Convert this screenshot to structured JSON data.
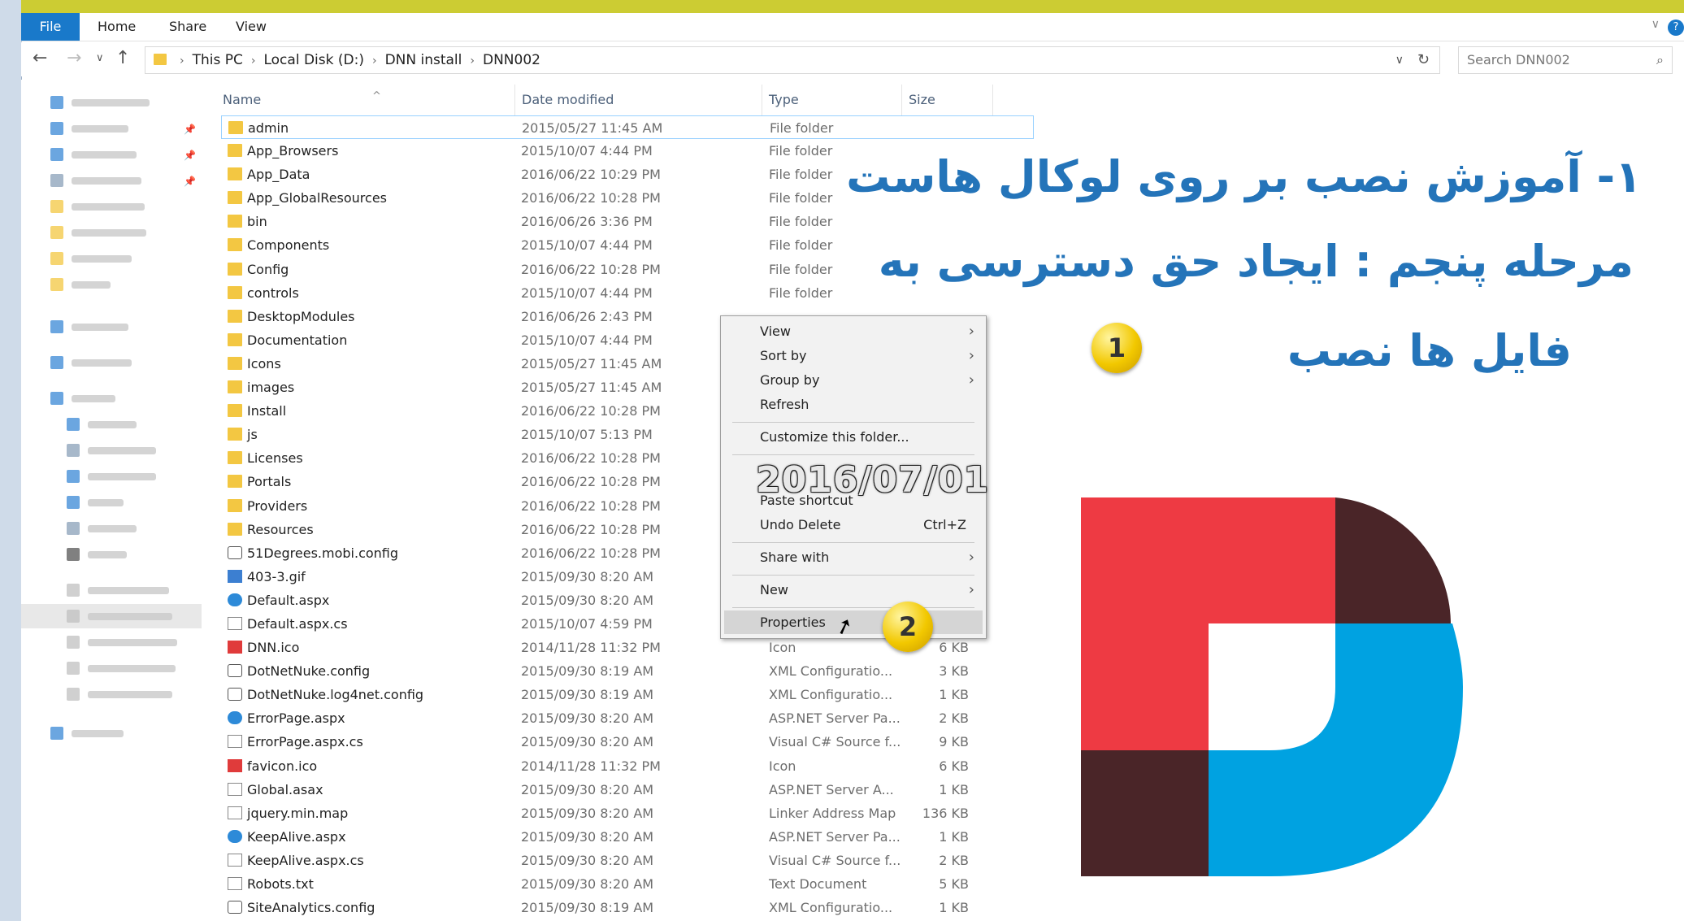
{
  "ribbon": {
    "tabs": [
      "File",
      "Home",
      "Share",
      "View"
    ]
  },
  "address": {
    "crumbs": [
      "This PC",
      "Local Disk (D:)",
      "DNN install",
      "DNN002"
    ]
  },
  "search": {
    "placeholder": "Search DNN002"
  },
  "columns": {
    "name": "Name",
    "date": "Date modified",
    "type": "Type",
    "size": "Size"
  },
  "files": [
    {
      "name": "admin",
      "date": "2015/05/27 11:45 AM",
      "type": "File folder",
      "size": "",
      "icon": "folder"
    },
    {
      "name": "App_Browsers",
      "date": "2015/10/07 4:44 PM",
      "type": "File folder",
      "size": "",
      "icon": "folder"
    },
    {
      "name": "App_Data",
      "date": "2016/06/22 10:29 PM",
      "type": "File folder",
      "size": "",
      "icon": "folder"
    },
    {
      "name": "App_GlobalResources",
      "date": "2016/06/22 10:28 PM",
      "type": "File folder",
      "size": "",
      "icon": "folder"
    },
    {
      "name": "bin",
      "date": "2016/06/26 3:36 PM",
      "type": "File folder",
      "size": "",
      "icon": "folder"
    },
    {
      "name": "Components",
      "date": "2015/10/07 4:44 PM",
      "type": "File folder",
      "size": "",
      "icon": "folder"
    },
    {
      "name": "Config",
      "date": "2016/06/22 10:28 PM",
      "type": "File folder",
      "size": "",
      "icon": "folder"
    },
    {
      "name": "controls",
      "date": "2015/10/07 4:44 PM",
      "type": "File folder",
      "size": "",
      "icon": "folder"
    },
    {
      "name": "DesktopModules",
      "date": "2016/06/26 2:43 PM",
      "type": "",
      "size": "",
      "icon": "folder"
    },
    {
      "name": "Documentation",
      "date": "2015/10/07 4:44 PM",
      "type": "",
      "size": "",
      "icon": "folder"
    },
    {
      "name": "Icons",
      "date": "2015/05/27 11:45 AM",
      "type": "",
      "size": "",
      "icon": "folder"
    },
    {
      "name": "images",
      "date": "2015/05/27 11:45 AM",
      "type": "",
      "size": "",
      "icon": "folder"
    },
    {
      "name": "Install",
      "date": "2016/06/22 10:28 PM",
      "type": "",
      "size": "",
      "icon": "folder"
    },
    {
      "name": "js",
      "date": "2015/10/07 5:13 PM",
      "type": "",
      "size": "",
      "icon": "folder"
    },
    {
      "name": "Licenses",
      "date": "2016/06/22 10:28 PM",
      "type": "",
      "size": "",
      "icon": "folder"
    },
    {
      "name": "Portals",
      "date": "2016/06/22 10:28 PM",
      "type": "",
      "size": "",
      "icon": "folder"
    },
    {
      "name": "Providers",
      "date": "2016/06/22 10:28 PM",
      "type": "",
      "size": "",
      "icon": "folder"
    },
    {
      "name": "Resources",
      "date": "2016/06/22 10:28 PM",
      "type": "",
      "size": "",
      "icon": "folder"
    },
    {
      "name": "51Degrees.mobi.config",
      "date": "2016/06/22 10:28 PM",
      "type": "",
      "size": "",
      "icon": "config"
    },
    {
      "name": "403-3.gif",
      "date": "2015/09/30 8:20 AM",
      "type": "",
      "size": "",
      "icon": "gif"
    },
    {
      "name": "Default.aspx",
      "date": "2015/09/30 8:20 AM",
      "type": "",
      "size": "",
      "icon": "web"
    },
    {
      "name": "Default.aspx.cs",
      "date": "2015/10/07 4:59 PM",
      "type": "",
      "size": "",
      "icon": "file"
    },
    {
      "name": "DNN.ico",
      "date": "2014/11/28 11:32 PM",
      "type": "Icon",
      "size": "6 KB",
      "icon": "dnn"
    },
    {
      "name": "DotNetNuke.config",
      "date": "2015/09/30 8:19 AM",
      "type": "XML Configuratio...",
      "size": "3 KB",
      "icon": "config"
    },
    {
      "name": "DotNetNuke.log4net.config",
      "date": "2015/09/30 8:19 AM",
      "type": "XML Configuratio...",
      "size": "1 KB",
      "icon": "config"
    },
    {
      "name": "ErrorPage.aspx",
      "date": "2015/09/30 8:20 AM",
      "type": "ASP.NET Server Pa...",
      "size": "2 KB",
      "icon": "web"
    },
    {
      "name": "ErrorPage.aspx.cs",
      "date": "2015/09/30 8:20 AM",
      "type": "Visual C# Source f...",
      "size": "9 KB",
      "icon": "file"
    },
    {
      "name": "favicon.ico",
      "date": "2014/11/28 11:32 PM",
      "type": "Icon",
      "size": "6 KB",
      "icon": "dnn"
    },
    {
      "name": "Global.asax",
      "date": "2015/09/30 8:20 AM",
      "type": "ASP.NET Server A...",
      "size": "1 KB",
      "icon": "file"
    },
    {
      "name": "jquery.min.map",
      "date": "2015/09/30 8:20 AM",
      "type": "Linker Address Map",
      "size": "136 KB",
      "icon": "file"
    },
    {
      "name": "KeepAlive.aspx",
      "date": "2015/09/30 8:20 AM",
      "type": "ASP.NET Server Pa...",
      "size": "1 KB",
      "icon": "web"
    },
    {
      "name": "KeepAlive.aspx.cs",
      "date": "2015/09/30 8:20 AM",
      "type": "Visual C# Source f...",
      "size": "2 KB",
      "icon": "file"
    },
    {
      "name": "Robots.txt",
      "date": "2015/09/30 8:20 AM",
      "type": "Text Document",
      "size": "5 KB",
      "icon": "file"
    },
    {
      "name": "SiteAnalytics.config",
      "date": "2015/09/30 8:19 AM",
      "type": "XML Configuratio...",
      "size": "1 KB",
      "icon": "config"
    }
  ],
  "context_menu": {
    "view": "View",
    "sort_by": "Sort by",
    "group_by": "Group by",
    "refresh": "Refresh",
    "customize": "Customize this folder...",
    "paste_shortcut": "Paste shortcut",
    "undo_delete": "Undo Delete",
    "undo_shortcut": "Ctrl+Z",
    "share_with": "Share with",
    "new": "New",
    "properties": "Properties"
  },
  "watermark": "2016/07/01",
  "badges": {
    "one": "1",
    "two": "2"
  },
  "persian_title": {
    "line1": "۱- آموزش نصب بر روی لوکال هاست",
    "line2": "مرحله پنجم : ایجاد حق دسترسی به",
    "line3": "فایل ها نصب"
  },
  "colors": {
    "accent": "#1979ca",
    "title_text": "#2474b9",
    "logo_red": "#ee3a43",
    "logo_dark": "#4a2528",
    "logo_blue": "#00a2e1"
  }
}
